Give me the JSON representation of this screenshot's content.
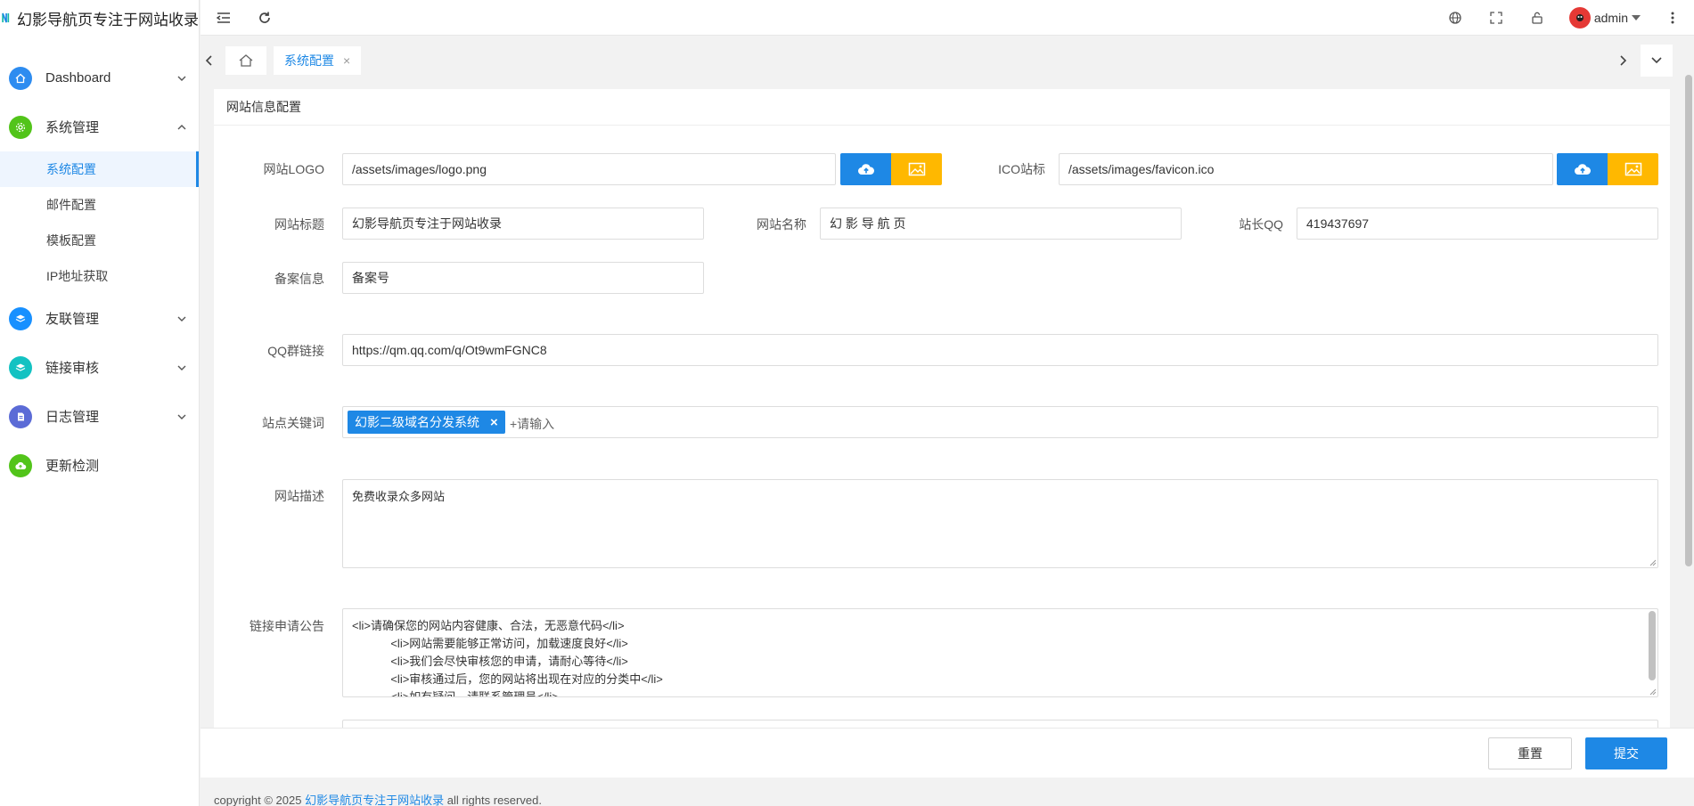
{
  "brand": {
    "title": "幻影导航页专注于网站收录"
  },
  "sidebar": {
    "items": [
      {
        "label": "Dashboard",
        "icon": "home-icon",
        "color": "#2d8cf0",
        "expanded": false
      },
      {
        "label": "系统管理",
        "icon": "settings-icon",
        "color": "#52c41a",
        "expanded": true,
        "children": [
          {
            "label": "系统配置",
            "active": true
          },
          {
            "label": "邮件配置"
          },
          {
            "label": "模板配置"
          },
          {
            "label": "IP地址获取"
          }
        ]
      },
      {
        "label": "友联管理",
        "icon": "layers-icon",
        "color": "#1890ff",
        "expanded": false
      },
      {
        "label": "链接审核",
        "icon": "layers-icon",
        "color": "#13c2c2",
        "expanded": false
      },
      {
        "label": "日志管理",
        "icon": "document-icon",
        "color": "#5b6bd6",
        "expanded": false
      },
      {
        "label": "更新检测",
        "icon": "cloud-icon",
        "color": "#52c41a"
      }
    ]
  },
  "topbar": {
    "user": "admin"
  },
  "tabs": {
    "current": "系统配置",
    "close": "×"
  },
  "card": {
    "title": "网站信息配置"
  },
  "form": {
    "logo_label": "网站LOGO",
    "logo_value": "/assets/images/logo.png",
    "ico_label": "ICO站标",
    "ico_value": "/assets/images/favicon.ico",
    "title_label": "网站标题",
    "title_value": "幻影导航页专注于网站收录",
    "name_label": "网站名称",
    "name_value": "幻 影 导 航 页",
    "qq_label": "站长QQ",
    "qq_value": "419437697",
    "beian_label": "备案信息",
    "beian_value": "备案号",
    "qqgroup_label": "QQ群链接",
    "qqgroup_value": "https://qm.qq.com/q/Ot9wmFGNC8",
    "keywords_label": "站点关键词",
    "keywords": [
      "幻影二级域名分发系统"
    ],
    "keywords_placeholder": "+请输入",
    "desc_label": "网站描述",
    "desc_value": "免费收录众多网站",
    "notice_label": "链接申请公告",
    "notice_lines": [
      "<li>请确保您的网站内容健康、合法，无恶意代码</li>",
      "            <li>网站需要能够正常访问，加载速度良好</li>",
      "            <li>我们会尽快审核您的申请，请耐心等待</li>",
      "            <li>审核通过后，您的网站将出现在对应的分类中</li>",
      "            <li>如有疑问，请联系管理员</li>"
    ]
  },
  "actions": {
    "reset": "重置",
    "submit": "提交"
  },
  "footer": {
    "prefix": "copyright © 2025 ",
    "link": "幻影导航页专注于网站收录",
    "suffix": " all rights reserved."
  }
}
